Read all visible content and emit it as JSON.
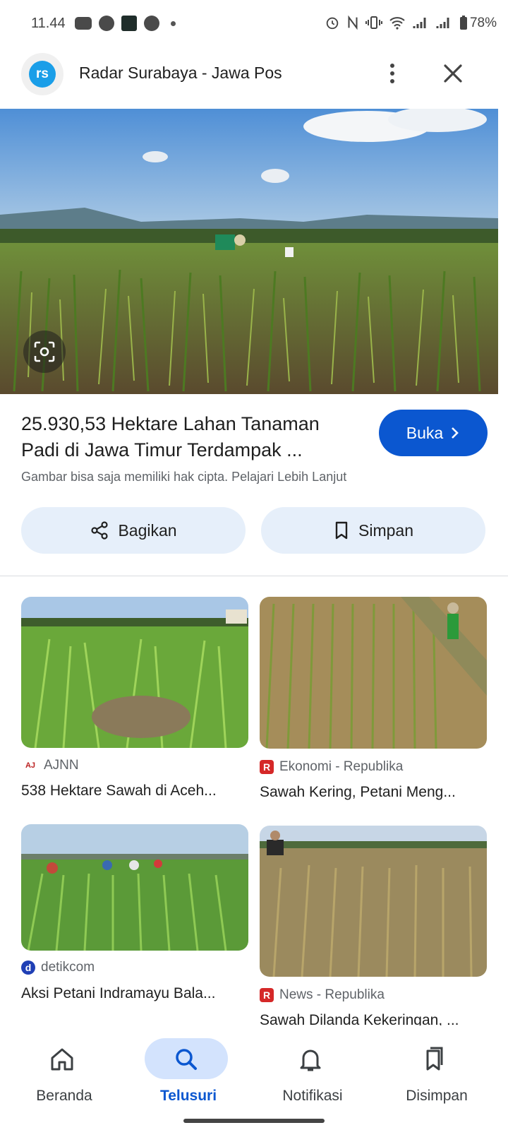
{
  "status_bar": {
    "time": "11.44",
    "battery": "78%"
  },
  "header": {
    "site_logo_text": "rs",
    "site_name": "Radar Surabaya - Jawa Pos"
  },
  "result": {
    "title_line1": "25.930,53 Hektare Lahan Tanaman",
    "title_line2": "Padi di Jawa Timur Terdampak ...",
    "open_label": "Buka",
    "copyright_note": "Gambar bisa saja memiliki hak cipta. Pelajari Lebih Lanjut",
    "share_label": "Bagikan",
    "save_label": "Simpan"
  },
  "related": [
    {
      "source": "AJNN",
      "title": "538 Hektare Sawah di Aceh..."
    },
    {
      "source": "Ekonomi - Republika",
      "title": "Sawah Kering, Petani Meng..."
    },
    {
      "source": "detikcom",
      "title": "Aksi Petani Indramayu Bala..."
    },
    {
      "source": "News - Republika",
      "title": "Sawah Dilanda Kekeringan, ..."
    }
  ],
  "nav": [
    {
      "label": "Beranda"
    },
    {
      "label": "Telusuri"
    },
    {
      "label": "Notifikasi"
    },
    {
      "label": "Disimpan"
    }
  ],
  "colors": {
    "accent": "#0b57d0",
    "chip_bg": "#e6effa",
    "nav_active_bg": "#d3e3fd"
  }
}
